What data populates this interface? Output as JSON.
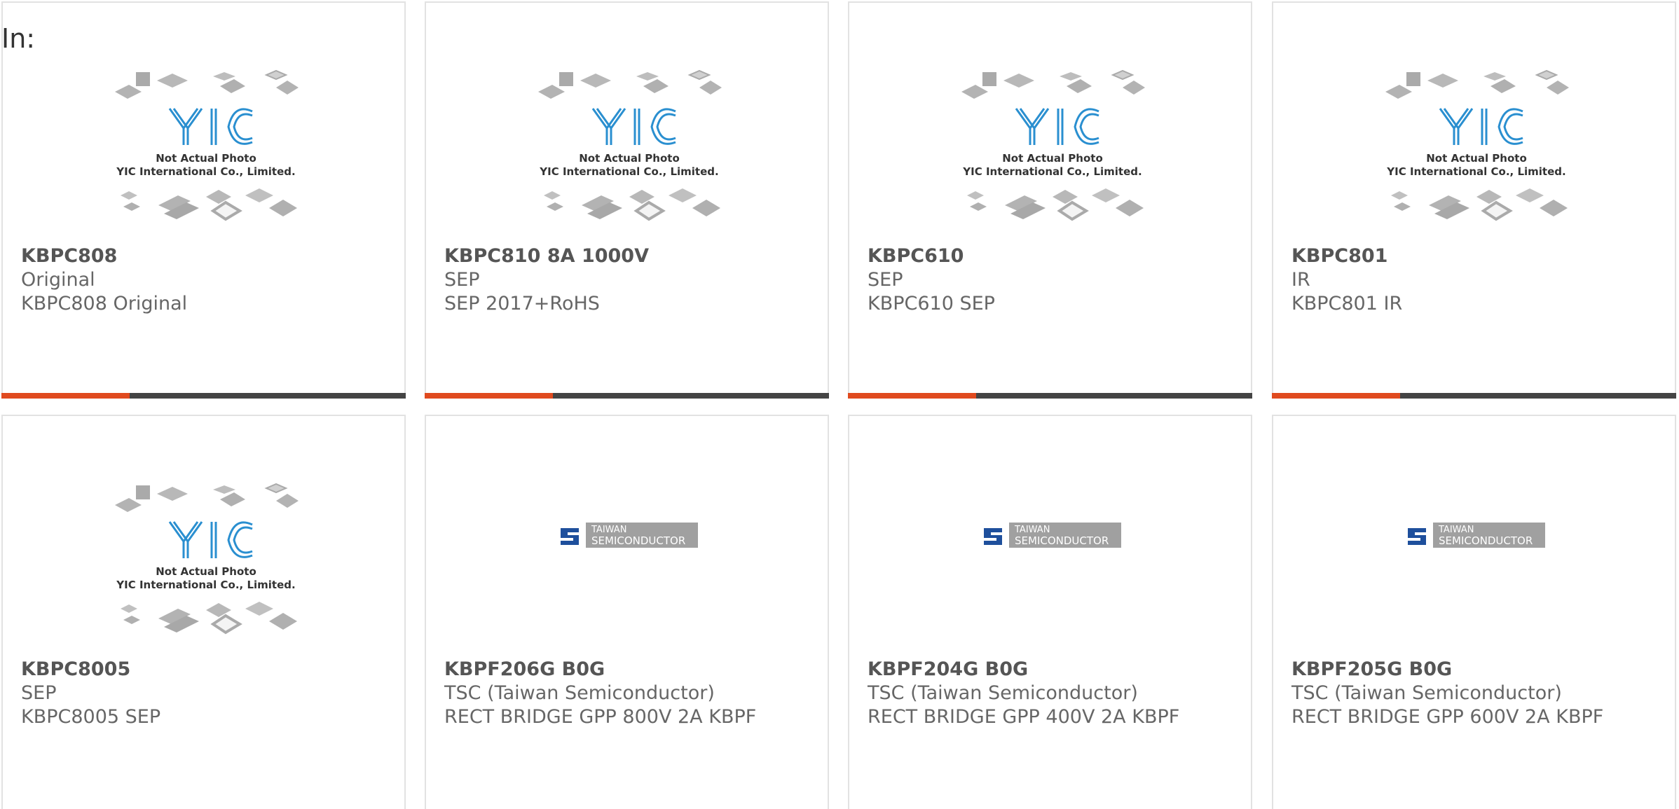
{
  "header": {
    "in_label": "In:"
  },
  "colors": {
    "accent": "#e04a1f",
    "bar": "#444444",
    "border": "#e2e2e2",
    "text": "#666666"
  },
  "placeholder": {
    "line1": "Not Actual Photo",
    "line2": "YIC International Co., Limited."
  },
  "tsc_logo": {
    "line1": "TAIWAN",
    "line2": "SEMICONDUCTOR"
  },
  "products": [
    {
      "part": "KBPC808",
      "mfr": "Original",
      "desc": "KBPC808 Original",
      "image": "yic-placeholder-icon"
    },
    {
      "part": "KBPC810 8A 1000V",
      "mfr": "SEP",
      "desc": "SEP 2017+RoHS",
      "image": "yic-placeholder-icon"
    },
    {
      "part": "KBPC610",
      "mfr": "SEP",
      "desc": "KBPC610 SEP",
      "image": "yic-placeholder-icon"
    },
    {
      "part": "KBPC801",
      "mfr": "IR",
      "desc": "KBPC801 IR",
      "image": "yic-placeholder-icon"
    },
    {
      "part": "KBPC8005",
      "mfr": "SEP",
      "desc": "KBPC8005 SEP",
      "image": "yic-placeholder-icon"
    },
    {
      "part": "KBPF206G B0G",
      "mfr": "TSC (Taiwan Semiconductor)",
      "desc": "RECT BRIDGE GPP 800V 2A KBPF",
      "image": "tsc-logo-icon"
    },
    {
      "part": "KBPF204G B0G",
      "mfr": "TSC (Taiwan Semiconductor)",
      "desc": "RECT BRIDGE GPP 400V 2A KBPF",
      "image": "tsc-logo-icon"
    },
    {
      "part": "KBPF205G B0G",
      "mfr": "TSC (Taiwan Semiconductor)",
      "desc": "RECT BRIDGE GPP 600V 2A KBPF",
      "image": "tsc-logo-icon"
    }
  ]
}
